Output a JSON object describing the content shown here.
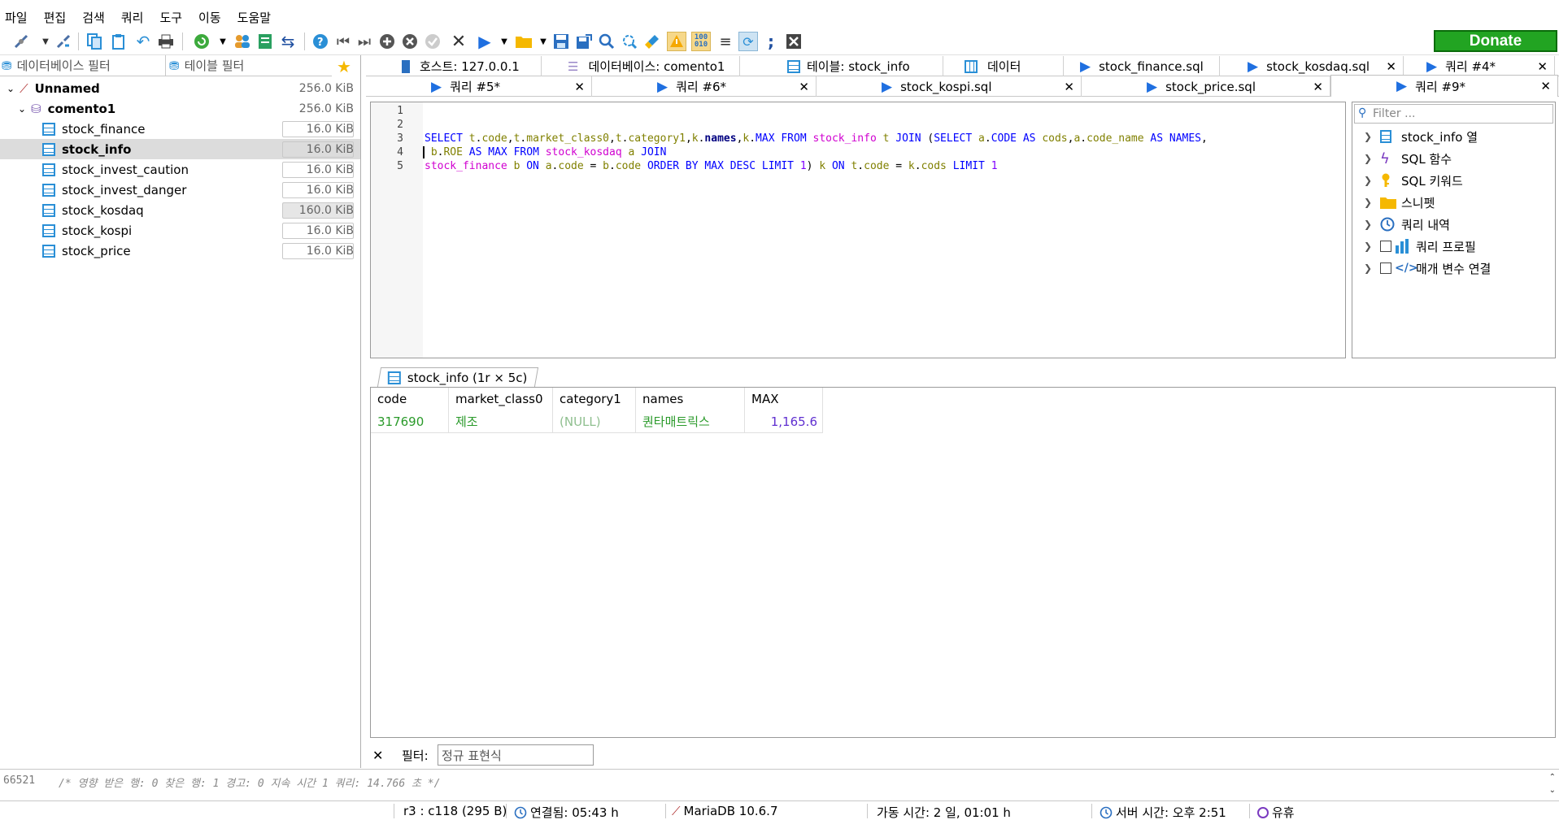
{
  "menu": [
    "파일",
    "편집",
    "검색",
    "쿼리",
    "도구",
    "이동",
    "도움말"
  ],
  "donate_label": "Donate",
  "left": {
    "db_filter_placeholder": "데이터베이스 필터",
    "table_filter_placeholder": "테이블 필터",
    "root": {
      "name": "Unnamed",
      "size": "256.0 KiB"
    },
    "db": {
      "name": "comento1",
      "size": "256.0 KiB"
    },
    "tables": [
      {
        "name": "stock_finance",
        "size": "16.0 KiB"
      },
      {
        "name": "stock_info",
        "size": "16.0 KiB"
      },
      {
        "name": "stock_invest_caution",
        "size": "16.0 KiB"
      },
      {
        "name": "stock_invest_danger",
        "size": "16.0 KiB"
      },
      {
        "name": "stock_kosdaq",
        "size": "160.0 KiB"
      },
      {
        "name": "stock_kospi",
        "size": "16.0 KiB"
      },
      {
        "name": "stock_price",
        "size": "16.0 KiB"
      }
    ]
  },
  "tabs_row1": [
    {
      "label": "호스트: 127.0.0.1"
    },
    {
      "label": "데이터베이스: comento1"
    },
    {
      "label": "테이블: stock_info"
    },
    {
      "label": "데이터"
    },
    {
      "label": "stock_finance.sql"
    },
    {
      "label": "stock_kosdaq.sql"
    },
    {
      "label": "쿼리 #4*"
    }
  ],
  "tabs_row2": [
    {
      "label": "쿼리 #5*"
    },
    {
      "label": "쿼리 #6*"
    },
    {
      "label": "stock_kospi.sql"
    },
    {
      "label": "stock_price.sql"
    },
    {
      "label": "쿼리 #9*"
    }
  ],
  "editor": {
    "line_numbers": [
      "1",
      "2",
      "3",
      "4",
      "5"
    ]
  },
  "helper": {
    "filter_placeholder": "Filter ...",
    "items": [
      "stock_info 열",
      "SQL 함수",
      "SQL 키워드",
      "스니펫",
      "쿼리 내역",
      "쿼리 프로필",
      "매개 변수 연결"
    ]
  },
  "result": {
    "tab_label": "stock_info (1r × 5c)",
    "columns": [
      "code",
      "market_class0",
      "category1",
      "names",
      "MAX"
    ],
    "rows": [
      [
        "317690",
        "제조",
        "(NULL)",
        "퀀타매트릭스",
        "1,165.6"
      ]
    ]
  },
  "filterbar": {
    "label": "필터:",
    "placeholder": "정규 표현식"
  },
  "log": {
    "id": "66521",
    "text": "/* 영향 받은 행: 0  찾은 행: 1  경고: 0  지속 시간 1 쿼리: 14.766 초 */"
  },
  "status": {
    "pos": "r3 : c118 (295 B)",
    "connected": "연결됨: 05:43 h",
    "server": "MariaDB 10.6.7",
    "uptime": "가동 시간: 2 일, 01:01 h",
    "server_time": "서버 시간: 오후 2:51",
    "idle": "유휴"
  },
  "colors": {
    "keyword": "#0000ff",
    "table": "#d000d0",
    "donate": "#22a422",
    "result_code": "#2a9a2a",
    "result_null": "#8fbf8f",
    "result_number": "#6030d0"
  }
}
